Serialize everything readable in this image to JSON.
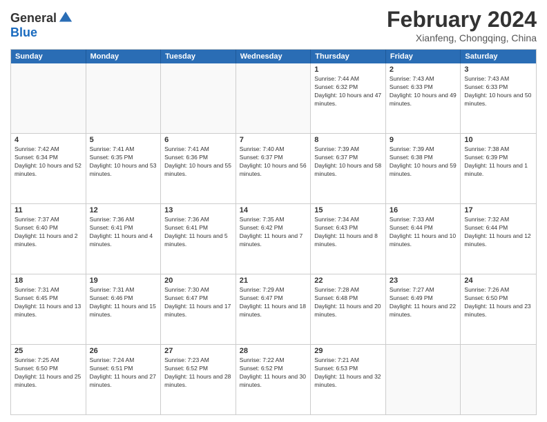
{
  "header": {
    "logo_general": "General",
    "logo_blue": "Blue",
    "month_title": "February 2024",
    "location": "Xianfeng, Chongqing, China"
  },
  "days_of_week": [
    "Sunday",
    "Monday",
    "Tuesday",
    "Wednesday",
    "Thursday",
    "Friday",
    "Saturday"
  ],
  "weeks": [
    [
      {
        "day": "",
        "empty": true
      },
      {
        "day": "",
        "empty": true
      },
      {
        "day": "",
        "empty": true
      },
      {
        "day": "",
        "empty": true
      },
      {
        "day": "1",
        "sunrise": "7:44 AM",
        "sunset": "6:32 PM",
        "daylight": "10 hours and 47 minutes."
      },
      {
        "day": "2",
        "sunrise": "7:43 AM",
        "sunset": "6:33 PM",
        "daylight": "10 hours and 49 minutes."
      },
      {
        "day": "3",
        "sunrise": "7:43 AM",
        "sunset": "6:33 PM",
        "daylight": "10 hours and 50 minutes."
      }
    ],
    [
      {
        "day": "4",
        "sunrise": "7:42 AM",
        "sunset": "6:34 PM",
        "daylight": "10 hours and 52 minutes."
      },
      {
        "day": "5",
        "sunrise": "7:41 AM",
        "sunset": "6:35 PM",
        "daylight": "10 hours and 53 minutes."
      },
      {
        "day": "6",
        "sunrise": "7:41 AM",
        "sunset": "6:36 PM",
        "daylight": "10 hours and 55 minutes."
      },
      {
        "day": "7",
        "sunrise": "7:40 AM",
        "sunset": "6:37 PM",
        "daylight": "10 hours and 56 minutes."
      },
      {
        "day": "8",
        "sunrise": "7:39 AM",
        "sunset": "6:37 PM",
        "daylight": "10 hours and 58 minutes."
      },
      {
        "day": "9",
        "sunrise": "7:39 AM",
        "sunset": "6:38 PM",
        "daylight": "10 hours and 59 minutes."
      },
      {
        "day": "10",
        "sunrise": "7:38 AM",
        "sunset": "6:39 PM",
        "daylight": "11 hours and 1 minute."
      }
    ],
    [
      {
        "day": "11",
        "sunrise": "7:37 AM",
        "sunset": "6:40 PM",
        "daylight": "11 hours and 2 minutes."
      },
      {
        "day": "12",
        "sunrise": "7:36 AM",
        "sunset": "6:41 PM",
        "daylight": "11 hours and 4 minutes."
      },
      {
        "day": "13",
        "sunrise": "7:36 AM",
        "sunset": "6:41 PM",
        "daylight": "11 hours and 5 minutes."
      },
      {
        "day": "14",
        "sunrise": "7:35 AM",
        "sunset": "6:42 PM",
        "daylight": "11 hours and 7 minutes."
      },
      {
        "day": "15",
        "sunrise": "7:34 AM",
        "sunset": "6:43 PM",
        "daylight": "11 hours and 8 minutes."
      },
      {
        "day": "16",
        "sunrise": "7:33 AM",
        "sunset": "6:44 PM",
        "daylight": "11 hours and 10 minutes."
      },
      {
        "day": "17",
        "sunrise": "7:32 AM",
        "sunset": "6:44 PM",
        "daylight": "11 hours and 12 minutes."
      }
    ],
    [
      {
        "day": "18",
        "sunrise": "7:31 AM",
        "sunset": "6:45 PM",
        "daylight": "11 hours and 13 minutes."
      },
      {
        "day": "19",
        "sunrise": "7:31 AM",
        "sunset": "6:46 PM",
        "daylight": "11 hours and 15 minutes."
      },
      {
        "day": "20",
        "sunrise": "7:30 AM",
        "sunset": "6:47 PM",
        "daylight": "11 hours and 17 minutes."
      },
      {
        "day": "21",
        "sunrise": "7:29 AM",
        "sunset": "6:47 PM",
        "daylight": "11 hours and 18 minutes."
      },
      {
        "day": "22",
        "sunrise": "7:28 AM",
        "sunset": "6:48 PM",
        "daylight": "11 hours and 20 minutes."
      },
      {
        "day": "23",
        "sunrise": "7:27 AM",
        "sunset": "6:49 PM",
        "daylight": "11 hours and 22 minutes."
      },
      {
        "day": "24",
        "sunrise": "7:26 AM",
        "sunset": "6:50 PM",
        "daylight": "11 hours and 23 minutes."
      }
    ],
    [
      {
        "day": "25",
        "sunrise": "7:25 AM",
        "sunset": "6:50 PM",
        "daylight": "11 hours and 25 minutes."
      },
      {
        "day": "26",
        "sunrise": "7:24 AM",
        "sunset": "6:51 PM",
        "daylight": "11 hours and 27 minutes."
      },
      {
        "day": "27",
        "sunrise": "7:23 AM",
        "sunset": "6:52 PM",
        "daylight": "11 hours and 28 minutes."
      },
      {
        "day": "28",
        "sunrise": "7:22 AM",
        "sunset": "6:52 PM",
        "daylight": "11 hours and 30 minutes."
      },
      {
        "day": "29",
        "sunrise": "7:21 AM",
        "sunset": "6:53 PM",
        "daylight": "11 hours and 32 minutes."
      },
      {
        "day": "",
        "empty": true
      },
      {
        "day": "",
        "empty": true
      }
    ]
  ]
}
